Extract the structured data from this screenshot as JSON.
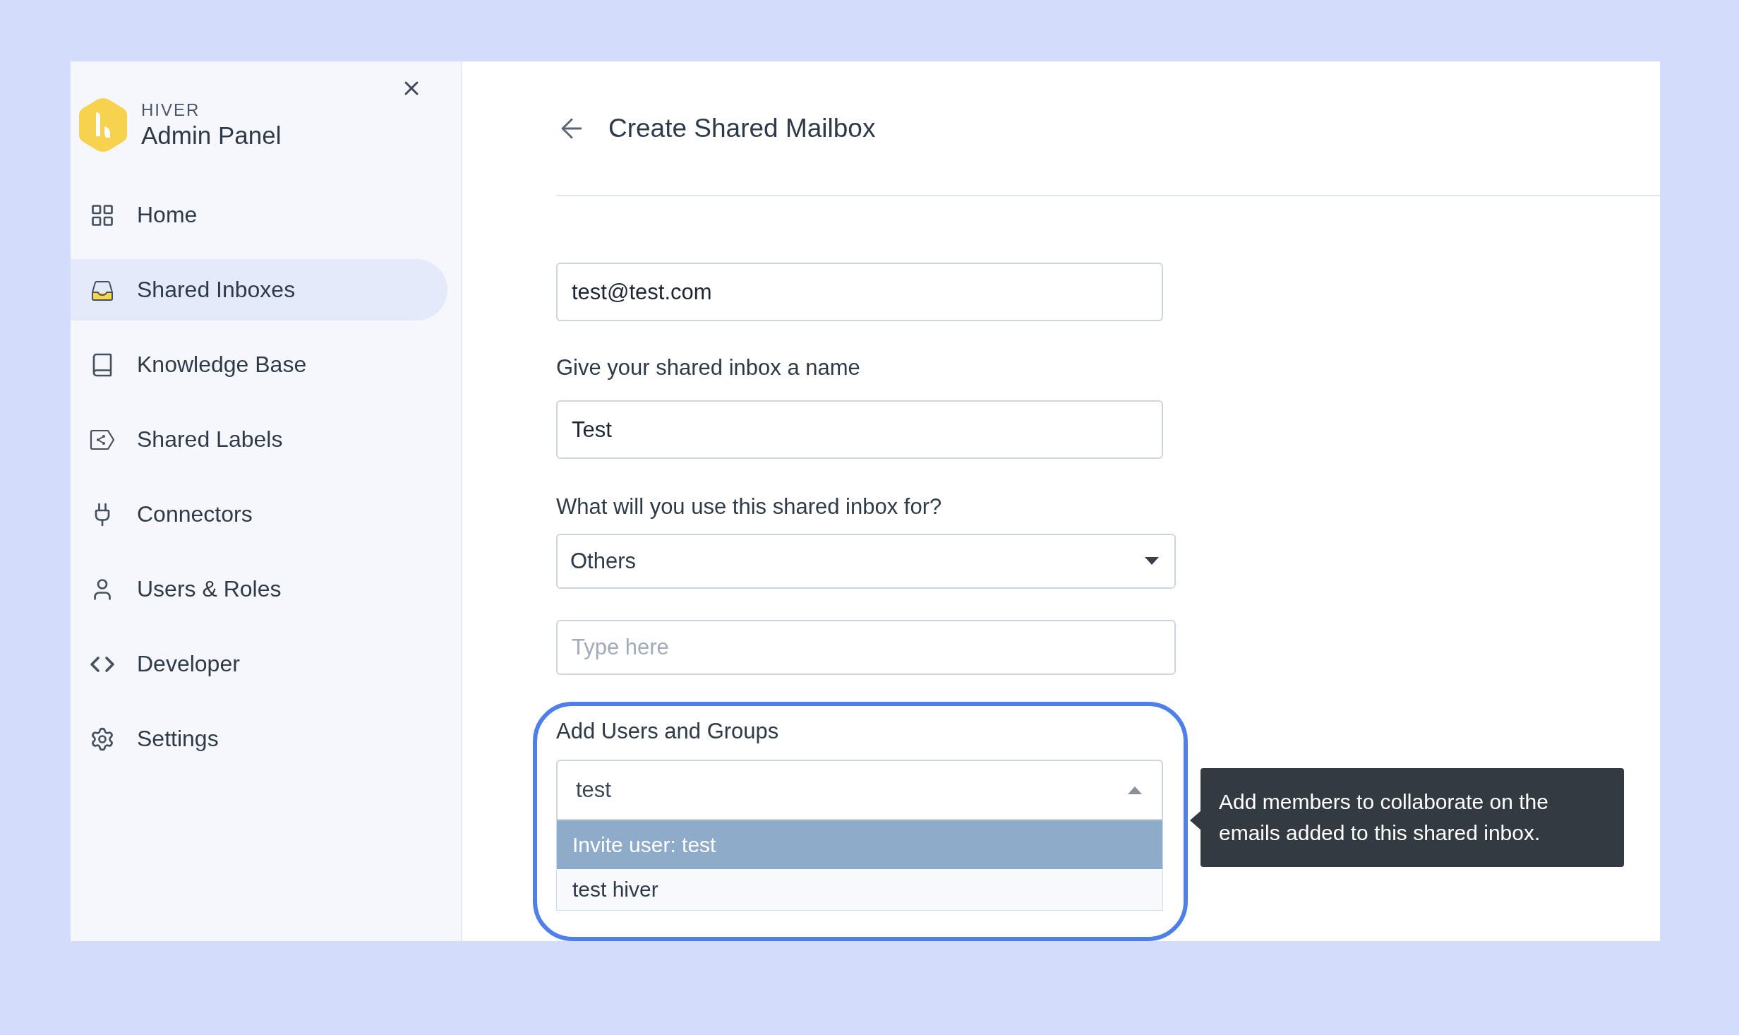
{
  "sidebar": {
    "brand": "HIVER",
    "title": "Admin Panel",
    "items": [
      {
        "label": "Home",
        "selected": false
      },
      {
        "label": "Shared Inboxes",
        "selected": true
      },
      {
        "label": "Knowledge Base",
        "selected": false
      },
      {
        "label": "Shared Labels",
        "selected": false
      },
      {
        "label": "Connectors",
        "selected": false
      },
      {
        "label": "Users & Roles",
        "selected": false
      },
      {
        "label": "Developer",
        "selected": false
      },
      {
        "label": "Settings",
        "selected": false
      }
    ]
  },
  "page": {
    "title": "Create Shared Mailbox"
  },
  "form": {
    "email": {
      "value": "test@test.com"
    },
    "name_label": "Give your shared inbox a name",
    "name": {
      "value": "Test"
    },
    "purpose_label": "What will you use this shared inbox for?",
    "purpose": {
      "value": "Others",
      "expanded": false
    },
    "purpose_detail": {
      "placeholder": "Type here"
    },
    "members_label": "Add Users and Groups",
    "members": {
      "value": "test",
      "expanded": true,
      "options": [
        {
          "label": "Invite user: test",
          "selected": true
        },
        {
          "label": "test hiver",
          "selected": false
        }
      ]
    }
  },
  "tooltip": {
    "text": "Add members to collaborate on the emails added to this shared inbox."
  }
}
